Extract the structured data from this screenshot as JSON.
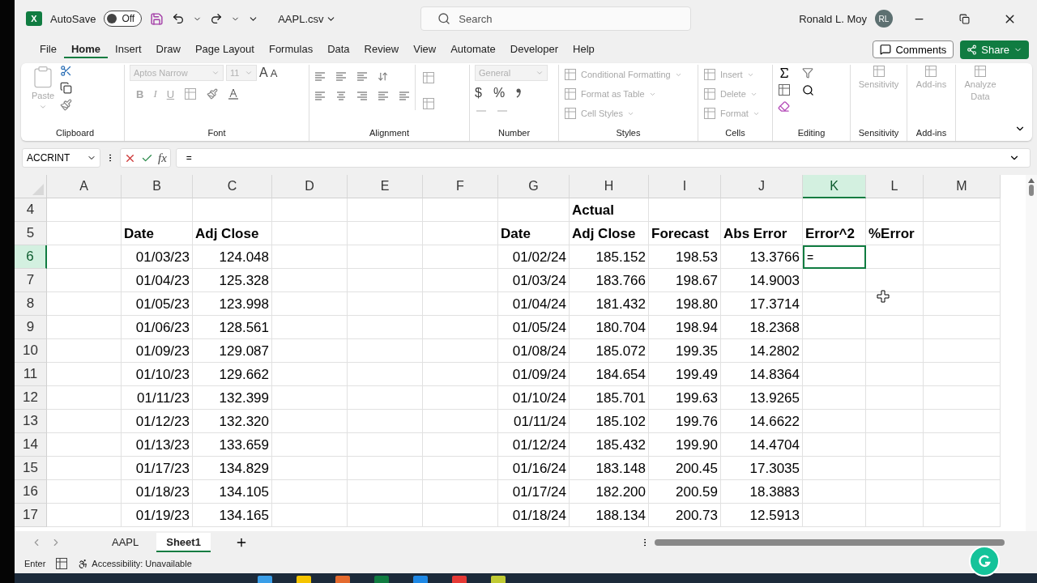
{
  "title_bar": {
    "logo_letter": "X",
    "autosave_label": "AutoSave",
    "autosave": {
      "on": false,
      "label": "Off"
    },
    "file_name": "AAPL.csv",
    "search_placeholder": "Search",
    "user_name": "Ronald L. Moy",
    "user_initials": "RL"
  },
  "menu_tabs": [
    {
      "label": "File",
      "selected": false
    },
    {
      "label": "Home",
      "selected": true
    },
    {
      "label": "Insert",
      "selected": false
    },
    {
      "label": "Draw",
      "selected": false
    },
    {
      "label": "Page Layout",
      "selected": false
    },
    {
      "label": "Formulas",
      "selected": false
    },
    {
      "label": "Data",
      "selected": false
    },
    {
      "label": "Review",
      "selected": false
    },
    {
      "label": "View",
      "selected": false
    },
    {
      "label": "Automate",
      "selected": false
    },
    {
      "label": "Developer",
      "selected": false
    },
    {
      "label": "Help",
      "selected": false
    }
  ],
  "comments_button": "Comments",
  "share_button": "Share",
  "ribbon": {
    "clipboard": {
      "label": "Clipboard",
      "paste": "Paste",
      "disabled": true
    },
    "font": {
      "label": "Font",
      "font_name": "Aptos Narrow",
      "font_size": "11",
      "grow": "A",
      "shrink": "A",
      "bold": "B",
      "italic": "I",
      "underline": "U",
      "disabled": true
    },
    "alignment": {
      "label": "Alignment"
    },
    "number": {
      "label": "Number",
      "format": "General",
      "currency": "$",
      "percent": "%",
      "disabled": true
    },
    "styles": {
      "label": "Styles",
      "items": [
        "Conditional Formatting",
        "Format as Table",
        "Cell Styles"
      ],
      "disabled": true
    },
    "cells": {
      "label": "Cells",
      "items": [
        "Insert",
        "Delete",
        "Format"
      ],
      "disabled": true
    },
    "editing": {
      "label": "Editing"
    },
    "sensitivity": {
      "label": "Sensitivity",
      "button": "Sensitivity",
      "disabled": true
    },
    "addins": {
      "label": "Add-ins",
      "button": "Add-ins",
      "disabled": true
    },
    "analyze": {
      "button_lines": [
        "Analyze",
        "Data"
      ],
      "disabled": true
    }
  },
  "formula_bar": {
    "name_box": "ACCRINT",
    "fx_label": "fx",
    "formula": "="
  },
  "sheet": {
    "columns": [
      {
        "label": "A",
        "selected": false
      },
      {
        "label": "B",
        "selected": false
      },
      {
        "label": "C",
        "selected": false
      },
      {
        "label": "D",
        "selected": false
      },
      {
        "label": "E",
        "selected": false
      },
      {
        "label": "F",
        "selected": false
      },
      {
        "label": "G",
        "selected": false
      },
      {
        "label": "H",
        "selected": false
      },
      {
        "label": "I",
        "selected": false
      },
      {
        "label": "J",
        "selected": false
      },
      {
        "label": "K",
        "selected": true
      },
      {
        "label": "L",
        "selected": false
      },
      {
        "label": "M",
        "selected": false
      }
    ],
    "rows": [
      {
        "number": "4",
        "selected": false,
        "kind": "header",
        "cells": [
          "",
          "",
          "",
          "",
          "",
          "",
          "",
          "Actual",
          "",
          "",
          "",
          "",
          ""
        ]
      },
      {
        "number": "5",
        "selected": false,
        "kind": "header",
        "cells": [
          "",
          "Date",
          "Adj Close",
          "",
          "",
          "",
          "Date",
          "Adj Close",
          "Forecast",
          "Abs Error",
          "Error^2",
          "%Error",
          ""
        ]
      },
      {
        "number": "6",
        "selected": true,
        "kind": "data",
        "cells": [
          "",
          "01/03/23",
          "124.048",
          "",
          "",
          "",
          "01/02/24",
          "185.152",
          "198.53",
          "13.3766",
          "=",
          "",
          ""
        ]
      },
      {
        "number": "7",
        "selected": false,
        "kind": "data",
        "cells": [
          "",
          "01/04/23",
          "125.328",
          "",
          "",
          "",
          "01/03/24",
          "183.766",
          "198.67",
          "14.9003",
          "",
          "",
          ""
        ]
      },
      {
        "number": "8",
        "selected": false,
        "kind": "data",
        "cells": [
          "",
          "01/05/23",
          "123.998",
          "",
          "",
          "",
          "01/04/24",
          "181.432",
          "198.80",
          "17.3714",
          "",
          "",
          ""
        ]
      },
      {
        "number": "9",
        "selected": false,
        "kind": "data",
        "cells": [
          "",
          "01/06/23",
          "128.561",
          "",
          "",
          "",
          "01/05/24",
          "180.704",
          "198.94",
          "18.2368",
          "",
          "",
          ""
        ]
      },
      {
        "number": "10",
        "selected": false,
        "kind": "data",
        "cells": [
          "",
          "01/09/23",
          "129.087",
          "",
          "",
          "",
          "01/08/24",
          "185.072",
          "199.35",
          "14.2802",
          "",
          "",
          ""
        ]
      },
      {
        "number": "11",
        "selected": false,
        "kind": "data",
        "cells": [
          "",
          "01/10/23",
          "129.662",
          "",
          "",
          "",
          "01/09/24",
          "184.654",
          "199.49",
          "14.8364",
          "",
          "",
          ""
        ]
      },
      {
        "number": "12",
        "selected": false,
        "kind": "data",
        "cells": [
          "",
          "01/11/23",
          "132.399",
          "",
          "",
          "",
          "01/10/24",
          "185.701",
          "199.63",
          "13.9265",
          "",
          "",
          ""
        ]
      },
      {
        "number": "13",
        "selected": false,
        "kind": "data",
        "cells": [
          "",
          "01/12/23",
          "132.320",
          "",
          "",
          "",
          "01/11/24",
          "185.102",
          "199.76",
          "14.6622",
          "",
          "",
          ""
        ]
      },
      {
        "number": "14",
        "selected": false,
        "kind": "data",
        "cells": [
          "",
          "01/13/23",
          "133.659",
          "",
          "",
          "",
          "01/12/24",
          "185.432",
          "199.90",
          "14.4704",
          "",
          "",
          ""
        ]
      },
      {
        "number": "15",
        "selected": false,
        "kind": "data",
        "cells": [
          "",
          "01/17/23",
          "134.829",
          "",
          "",
          "",
          "01/16/24",
          "183.148",
          "200.45",
          "17.3035",
          "",
          "",
          ""
        ]
      },
      {
        "number": "16",
        "selected": false,
        "kind": "data",
        "cells": [
          "",
          "01/18/23",
          "134.105",
          "",
          "",
          "",
          "01/17/24",
          "182.200",
          "200.59",
          "18.3883",
          "",
          "",
          ""
        ]
      },
      {
        "number": "17",
        "selected": false,
        "kind": "data",
        "cells": [
          "",
          "01/19/23",
          "134.165",
          "",
          "",
          "",
          "01/18/24",
          "188.134",
          "200.73",
          "12.5913",
          "",
          "",
          ""
        ]
      }
    ]
  },
  "sheet_tabs": [
    {
      "label": "AAPL",
      "selected": false
    },
    {
      "label": "Sheet1",
      "selected": true
    }
  ],
  "status_bar": {
    "mode": "Enter",
    "accessibility": "Accessibility: Unavailable"
  }
}
